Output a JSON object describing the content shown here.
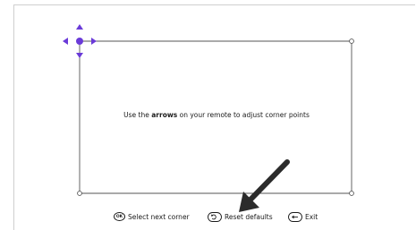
{
  "instruction": {
    "before": "Use the ",
    "bold": "arrows",
    "after": " on your remote to adjust corner points"
  },
  "footer": {
    "select": {
      "key": "OK",
      "label": "Select next corner",
      "icon": "ok-key-icon"
    },
    "reset": {
      "label": "Reset defaults",
      "icon": "reset-key-icon"
    },
    "exit": {
      "label": "Exit",
      "icon": "back-key-icon"
    }
  },
  "colors": {
    "accent": "#6a3ad8",
    "frame": "#555555",
    "arrow": "#2b2b2b"
  }
}
